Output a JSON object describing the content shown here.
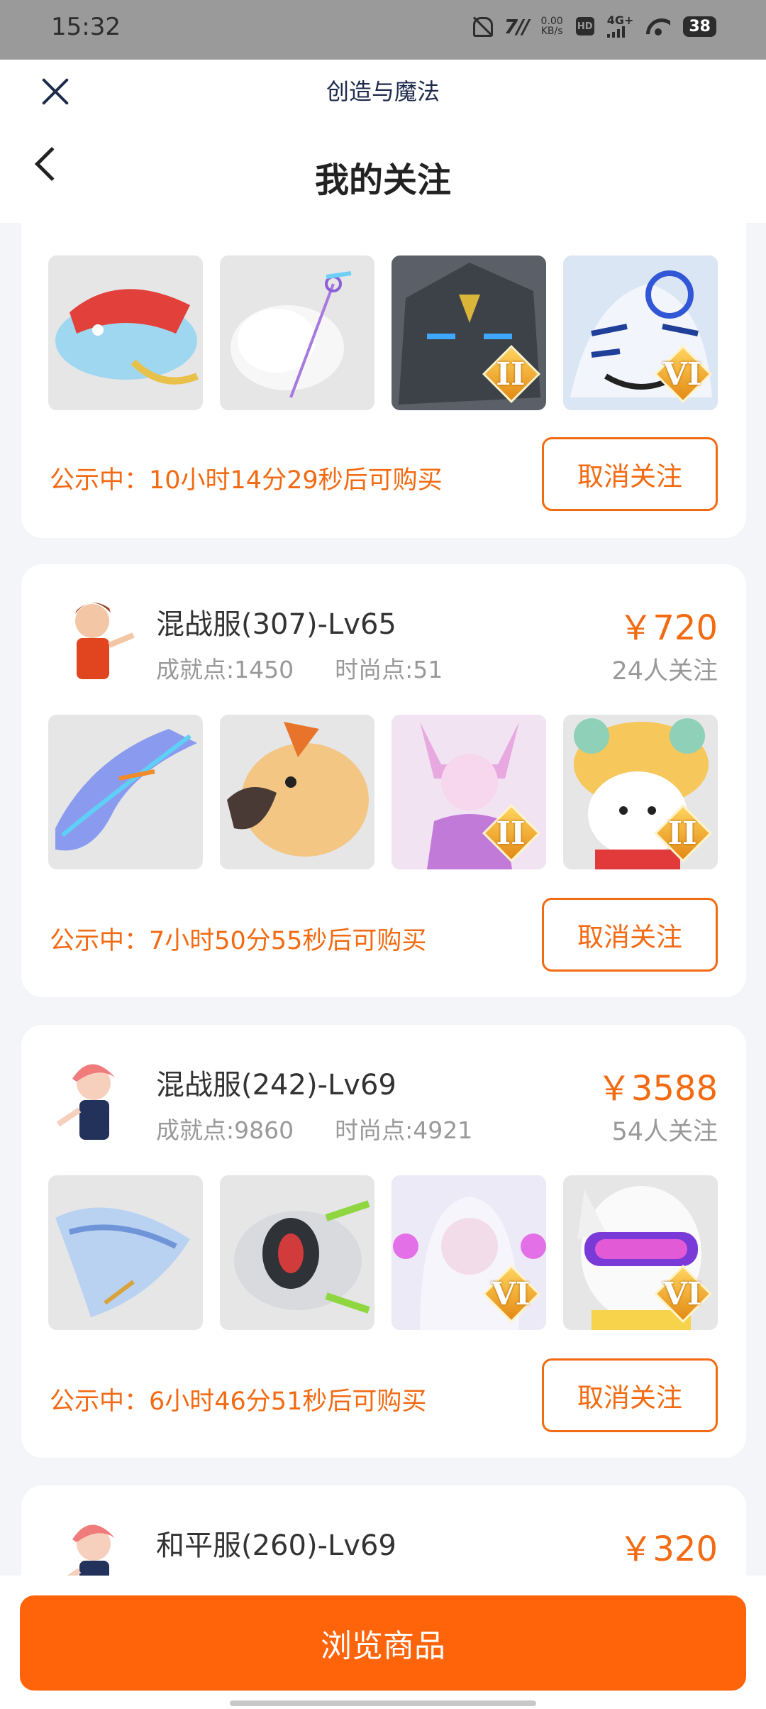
{
  "status_bar": {
    "time": "15:32",
    "net_speed_top": "0.00",
    "net_speed_bottom": "KB/s",
    "hd": "HD",
    "network": "4G+",
    "battery": "38",
    "carrier_mark": "7//"
  },
  "header": {
    "app_title": "创造与魔法",
    "page_title": "我的关注"
  },
  "cards": [
    {
      "item_badges": [
        "",
        "",
        "II",
        "VI"
      ],
      "notice": "公示中：10小时14分29秒后可购买",
      "unfollow_label": "取消关注"
    },
    {
      "server": "混战服(307)-Lv65",
      "achievement": "成就点:1450",
      "fashion": "时尚点:51",
      "price": "￥720",
      "followers": "24人关注",
      "item_badges": [
        "",
        "",
        "II",
        "II"
      ],
      "notice": "公示中：7小时50分55秒后可购买",
      "unfollow_label": "取消关注"
    },
    {
      "server": "混战服(242)-Lv69",
      "achievement": "成就点:9860",
      "fashion": "时尚点:4921",
      "price": "￥3588",
      "followers": "54人关注",
      "item_badges": [
        "",
        "",
        "VI",
        "VI"
      ],
      "notice": "公示中：6小时46分51秒后可购买",
      "unfollow_label": "取消关注"
    },
    {
      "server": "和平服(260)-Lv69",
      "price": "￥320"
    }
  ],
  "bottom": {
    "browse_label": "浏览商品"
  },
  "colors": {
    "accent": "#f26a12",
    "button": "#ff640a"
  }
}
